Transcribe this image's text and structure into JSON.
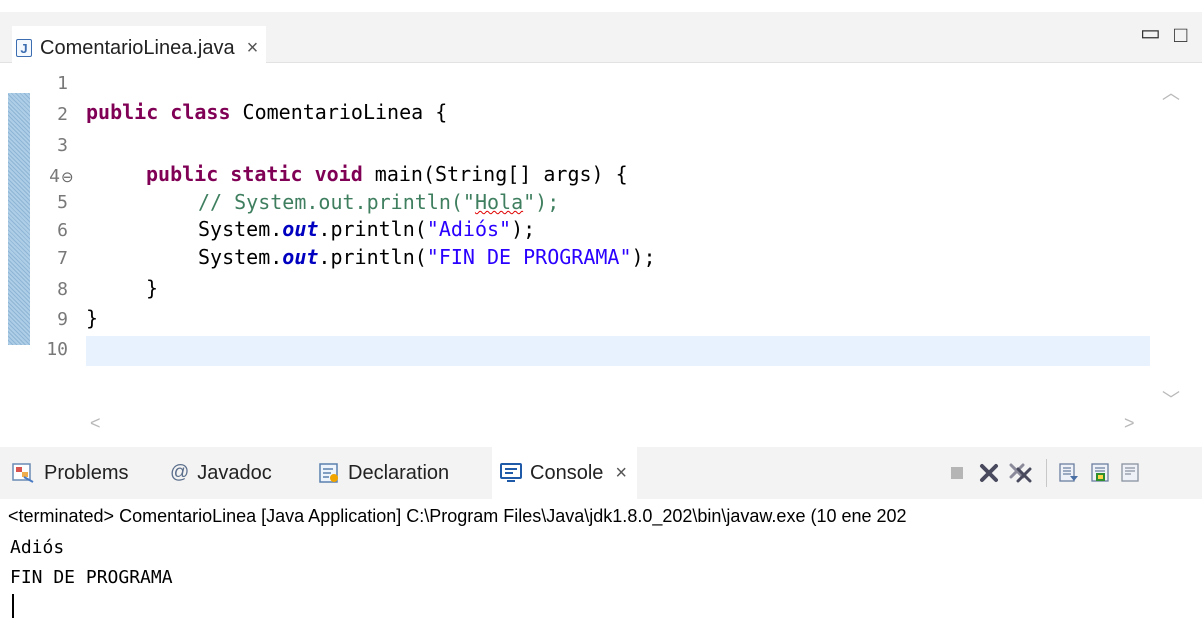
{
  "editor": {
    "tab_title": "ComentarioLinea.java",
    "tab_close": "×",
    "minimize": "▭",
    "maximize": "□"
  },
  "code": {
    "line_numbers": [
      "1",
      "2",
      "3",
      "4",
      "5",
      "6",
      "7",
      "8",
      "9",
      "10"
    ],
    "folded_line_marker": "⊖",
    "lines": {
      "l2_kw": "public class",
      "l2_rest": " ComentarioLinea {",
      "l4_kw": "public static void",
      "l4_rest": " main(String[] args) {",
      "l5_comment_a": "// System.out.println(\"",
      "l5_comment_word": "Hola",
      "l5_comment_b": "\");",
      "l6_a": "System.",
      "l6_field": "out",
      "l6_b": ".println(",
      "l6_str": "\"Adiós\"",
      "l6_c": ");",
      "l7_a": "System.",
      "l7_field": "out",
      "l7_b": ".println(",
      "l7_str": "\"FIN DE PROGRAMA\"",
      "l7_c": ");",
      "l8": "}",
      "l9": "}"
    }
  },
  "views": {
    "tabs": [
      {
        "label": "Problems",
        "icon": "problems-icon"
      },
      {
        "label": "Javadoc",
        "icon": "at-icon"
      },
      {
        "label": "Declaration",
        "icon": "declaration-icon"
      },
      {
        "label": "Console",
        "icon": "console-icon"
      }
    ],
    "console_close": "×"
  },
  "console": {
    "status": "<terminated> ComentarioLinea [Java Application] C:\\Program Files\\Java\\jdk1.8.0_202\\bin\\javaw.exe  (10 ene 202",
    "output": [
      "Adiós",
      "FIN DE PROGRAMA"
    ]
  },
  "colors": {
    "keyword": "#7f0055",
    "string": "#2a00ff",
    "comment": "#3f7f5f",
    "field": "#0000c0",
    "current_line": "#e8f2fe"
  }
}
